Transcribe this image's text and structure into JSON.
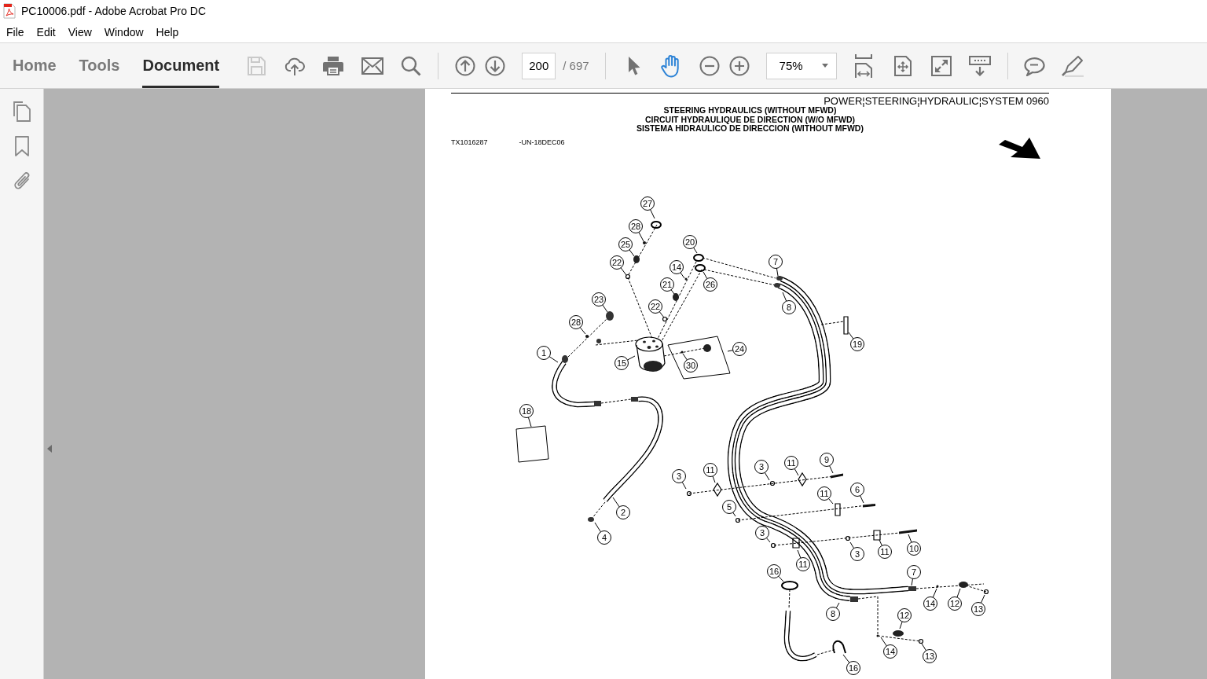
{
  "window": {
    "title": "PC10006.pdf - Adobe Acrobat Pro DC"
  },
  "menu": [
    "File",
    "Edit",
    "View",
    "Window",
    "Help"
  ],
  "toolbar": {
    "tabs": [
      {
        "label": "Home",
        "selected": false
      },
      {
        "label": "Tools",
        "selected": false
      },
      {
        "label": "Document",
        "selected": true
      }
    ],
    "save_button": {
      "disabled": true
    },
    "page_field": {
      "value": "200"
    },
    "page_count": "/ 697",
    "select_tool": {
      "selected": false
    },
    "hand_tool": {
      "selected": true
    },
    "zoom_field": {
      "value": "75%"
    }
  },
  "document_page": {
    "section_code": "POWER¦STEERING¦HYDRAULIC¦SYSTEM 0960",
    "titles": [
      "STEERING HYDRAULICS (WITHOUT MFWD)",
      "CIRCUIT HYDRAULIQUE DE DIRECTION (W/O MFWD)",
      "SISTEMA HIDRAULICO DE DIRECCION (WITHOUT MFWD)"
    ],
    "figure_number": "TX1016287",
    "figure_code": "-UN-18DEC06",
    "callouts": [
      "27",
      "28",
      "25",
      "20",
      "22",
      "7",
      "14",
      "21",
      "26",
      "23",
      "22",
      "8",
      "28",
      "19",
      "24",
      "1",
      "15",
      "30",
      "18",
      "9",
      "11",
      "3",
      "11",
      "3",
      "6",
      "11",
      "5",
      "2",
      "3",
      "4",
      "10",
      "3",
      "11",
      "11",
      "16",
      "7",
      "14",
      "12",
      "13",
      "8",
      "12",
      "14",
      "13",
      "16"
    ]
  }
}
